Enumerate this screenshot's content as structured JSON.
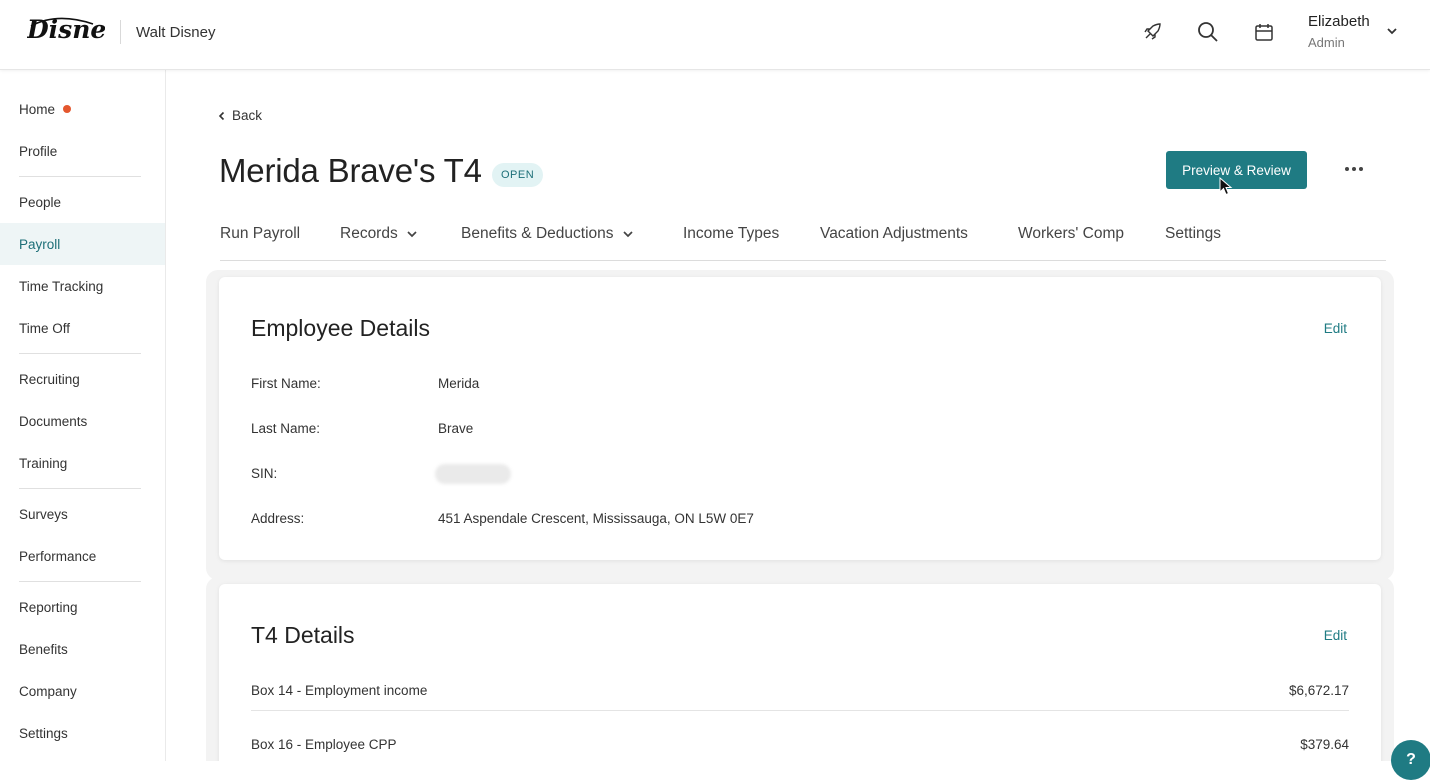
{
  "header": {
    "logo_text": "Disney",
    "company": "Walt Disney",
    "user": {
      "name": "Elizabeth",
      "role": "Admin"
    },
    "icons": [
      "rocket-icon",
      "search-icon",
      "calendar-icon",
      "chevron-down-icon"
    ]
  },
  "sidebar": {
    "items": [
      {
        "label": "Home",
        "notification": true
      },
      {
        "label": "Profile"
      },
      {
        "label": "People"
      },
      {
        "label": "Payroll",
        "active": true
      },
      {
        "label": "Time Tracking"
      },
      {
        "label": "Time Off"
      },
      {
        "label": "Recruiting"
      },
      {
        "label": "Documents"
      },
      {
        "label": "Training"
      },
      {
        "label": "Surveys"
      },
      {
        "label": "Performance"
      },
      {
        "label": "Reporting"
      },
      {
        "label": "Benefits"
      },
      {
        "label": "Company"
      },
      {
        "label": "Settings"
      }
    ],
    "accent_color": "#1d6f78",
    "dot_color": "#e4572e"
  },
  "page": {
    "back_label": "Back",
    "title": "Merida Brave's T4",
    "status_badge": "OPEN",
    "primary_button": "Preview & Review",
    "tabs": [
      {
        "label": "Run Payroll"
      },
      {
        "label": "Records",
        "dropdown": true
      },
      {
        "label": "Benefits & Deductions",
        "dropdown": true
      },
      {
        "label": "Income Types"
      },
      {
        "label": "Vacation Adjustments"
      },
      {
        "label": "Workers' Comp"
      },
      {
        "label": "Settings"
      }
    ]
  },
  "employee_details": {
    "title": "Employee Details",
    "edit_label": "Edit",
    "fields": [
      {
        "label": "First Name:",
        "value": "Merida"
      },
      {
        "label": "Last Name:",
        "value": "Brave"
      },
      {
        "label": "SIN:",
        "value": "",
        "redacted": true
      },
      {
        "label": "Address:",
        "value": "451 Aspendale Crescent, Mississauga, ON L5W 0E7"
      }
    ]
  },
  "t4_details": {
    "title": "T4 Details",
    "edit_label": "Edit",
    "rows": [
      {
        "label": "Box 14 - Employment income",
        "value": "$6,672.17"
      },
      {
        "label": "Box 16 - Employee CPP",
        "value": "$379.64"
      }
    ]
  },
  "help_label": "?"
}
